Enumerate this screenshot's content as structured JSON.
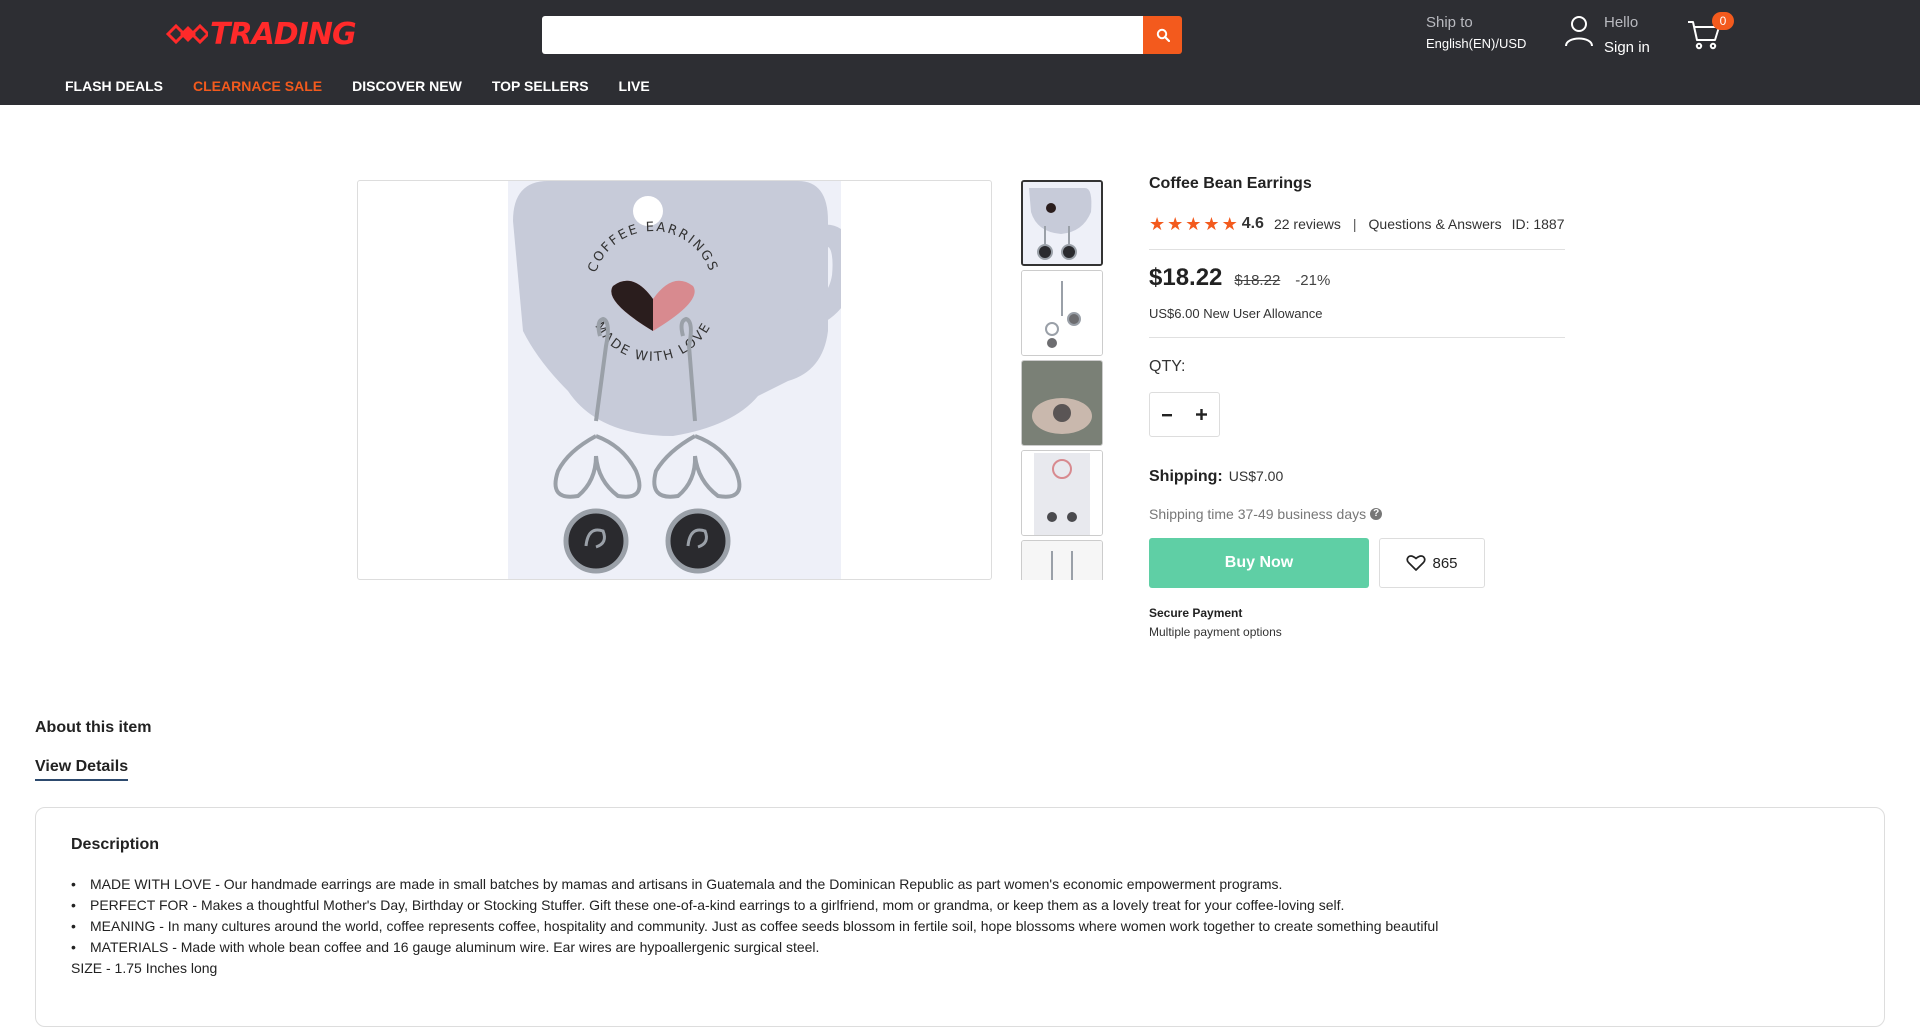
{
  "header": {
    "logo_text": "TRADING",
    "search": {
      "value": "",
      "placeholder": ""
    },
    "ship_to_label": "Ship to",
    "ship_to_value": "English(EN)/USD",
    "hello": "Hello",
    "sign_in": "Sign in",
    "cart_count": "0",
    "nav": [
      {
        "label": "FLASH DEALS"
      },
      {
        "label": "CLEARNACE SALE"
      },
      {
        "label": "DISCOVER NEW"
      },
      {
        "label": "TOP SELLERS"
      },
      {
        "label": "LIVE"
      }
    ]
  },
  "product": {
    "title": "Coffee Bean Earrings",
    "rating": "4.6",
    "stars": 5,
    "reviews": "22 reviews",
    "separator": "|",
    "qa": "Questions & Answers",
    "id": "ID: 1887",
    "price": "$18.22",
    "old_price": "$18.22",
    "discount": "-21%",
    "allowance": "US$6.00 New User Allowance",
    "qty_label": "QTY:",
    "shipping_label": "Shipping:",
    "shipping_value": "US$7.00",
    "shipping_time": "Shipping time 37-49 business days",
    "buy_now": "Buy Now",
    "wishlist_count": "865",
    "secure_title": "Secure Payment",
    "secure_sub": "Multiple payment options",
    "image_text_top": "COFFEE EARRINGS",
    "image_text_bottom": "MADE WITH LOVE"
  },
  "about": {
    "heading": "About this item",
    "tab": "View Details",
    "desc_title": "Description",
    "bullets": [
      "MADE WITH LOVE - Our handmade earrings are made in small batches by mamas and artisans in Guatemala and the Dominican Republic as part women's economic empowerment programs.",
      "PERFECT FOR - Makes a thoughtful Mother's Day, Birthday or Stocking Stuffer. Gift these one-of-a-kind earrings to a girlfriend, mom or grandma, or keep them as a lovely treat for your coffee-loving self.",
      "MEANING - In many cultures around the world, coffee represents coffee, hospitality and community. Just as coffee seeds blossom in fertile soil, hope blossoms where women work together to create something beautiful",
      "MATERIALS - Made with whole bean coffee and 16 gauge aluminum wire. Ear wires are hypoallergenic surgical steel."
    ],
    "size": "SIZE - 1.75 Inches long"
  },
  "colors": {
    "header_bg": "#2d2e33",
    "accent": "#f35a1d",
    "buy_button": "#5fcfa5",
    "logo": "#ff2a2a"
  }
}
